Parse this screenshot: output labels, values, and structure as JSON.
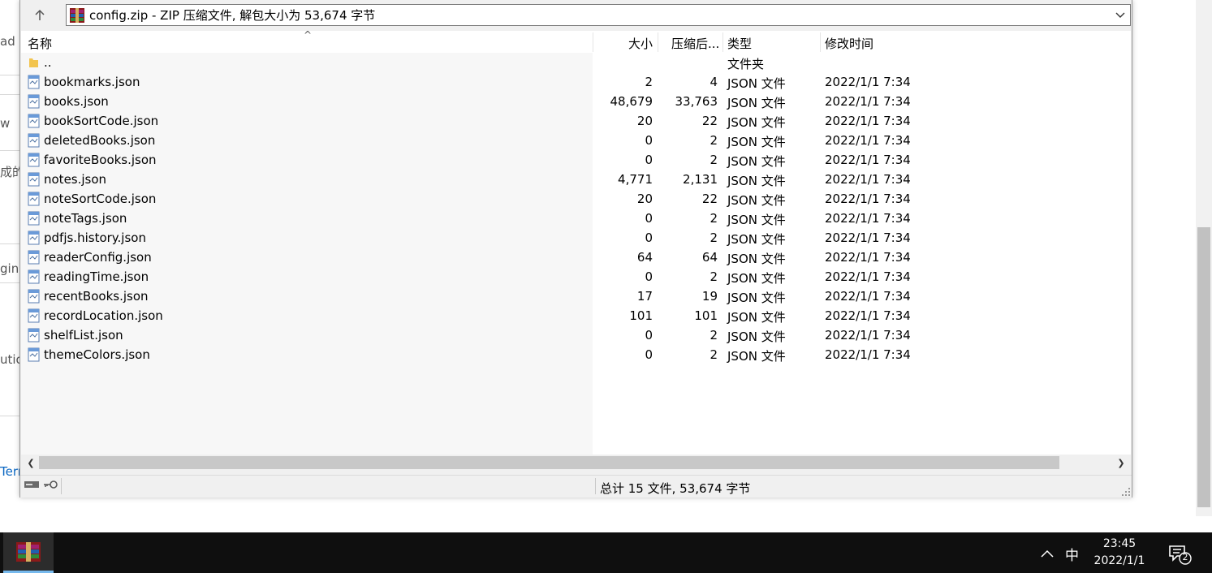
{
  "background_page": {
    "fragments": [
      "ad",
      "w",
      "成的",
      "ging",
      "ution",
      "Terr"
    ]
  },
  "window": {
    "address_text": "config.zip - ZIP 压缩文件, 解包大小为 53,674 字节",
    "columns": {
      "name": "名称",
      "size": "大小",
      "packed": "压缩后...",
      "type": "类型",
      "modified": "修改时间"
    },
    "parent_row": {
      "name": "..",
      "type": "文件夹"
    },
    "files": [
      {
        "name": "bookmarks.json",
        "size": "2",
        "packed": "4",
        "type": "JSON 文件",
        "modified": "2022/1/1 7:34"
      },
      {
        "name": "books.json",
        "size": "48,679",
        "packed": "33,763",
        "type": "JSON 文件",
        "modified": "2022/1/1 7:34"
      },
      {
        "name": "bookSortCode.json",
        "size": "20",
        "packed": "22",
        "type": "JSON 文件",
        "modified": "2022/1/1 7:34"
      },
      {
        "name": "deletedBooks.json",
        "size": "0",
        "packed": "2",
        "type": "JSON 文件",
        "modified": "2022/1/1 7:34"
      },
      {
        "name": "favoriteBooks.json",
        "size": "0",
        "packed": "2",
        "type": "JSON 文件",
        "modified": "2022/1/1 7:34"
      },
      {
        "name": "notes.json",
        "size": "4,771",
        "packed": "2,131",
        "type": "JSON 文件",
        "modified": "2022/1/1 7:34"
      },
      {
        "name": "noteSortCode.json",
        "size": "20",
        "packed": "22",
        "type": "JSON 文件",
        "modified": "2022/1/1 7:34"
      },
      {
        "name": "noteTags.json",
        "size": "0",
        "packed": "2",
        "type": "JSON 文件",
        "modified": "2022/1/1 7:34"
      },
      {
        "name": "pdfjs.history.json",
        "size": "0",
        "packed": "2",
        "type": "JSON 文件",
        "modified": "2022/1/1 7:34"
      },
      {
        "name": "readerConfig.json",
        "size": "64",
        "packed": "64",
        "type": "JSON 文件",
        "modified": "2022/1/1 7:34"
      },
      {
        "name": "readingTime.json",
        "size": "0",
        "packed": "2",
        "type": "JSON 文件",
        "modified": "2022/1/1 7:34"
      },
      {
        "name": "recentBooks.json",
        "size": "17",
        "packed": "19",
        "type": "JSON 文件",
        "modified": "2022/1/1 7:34"
      },
      {
        "name": "recordLocation.json",
        "size": "101",
        "packed": "101",
        "type": "JSON 文件",
        "modified": "2022/1/1 7:34"
      },
      {
        "name": "shelfList.json",
        "size": "0",
        "packed": "2",
        "type": "JSON 文件",
        "modified": "2022/1/1 7:34"
      },
      {
        "name": "themeColors.json",
        "size": "0",
        "packed": "2",
        "type": "JSON 文件",
        "modified": "2022/1/1 7:34"
      }
    ],
    "status_text": "总计 15 文件, 53,674 字节"
  },
  "taskbar": {
    "ime": "中",
    "time": "23:45",
    "date": "2022/1/1",
    "notification_count": "2"
  }
}
